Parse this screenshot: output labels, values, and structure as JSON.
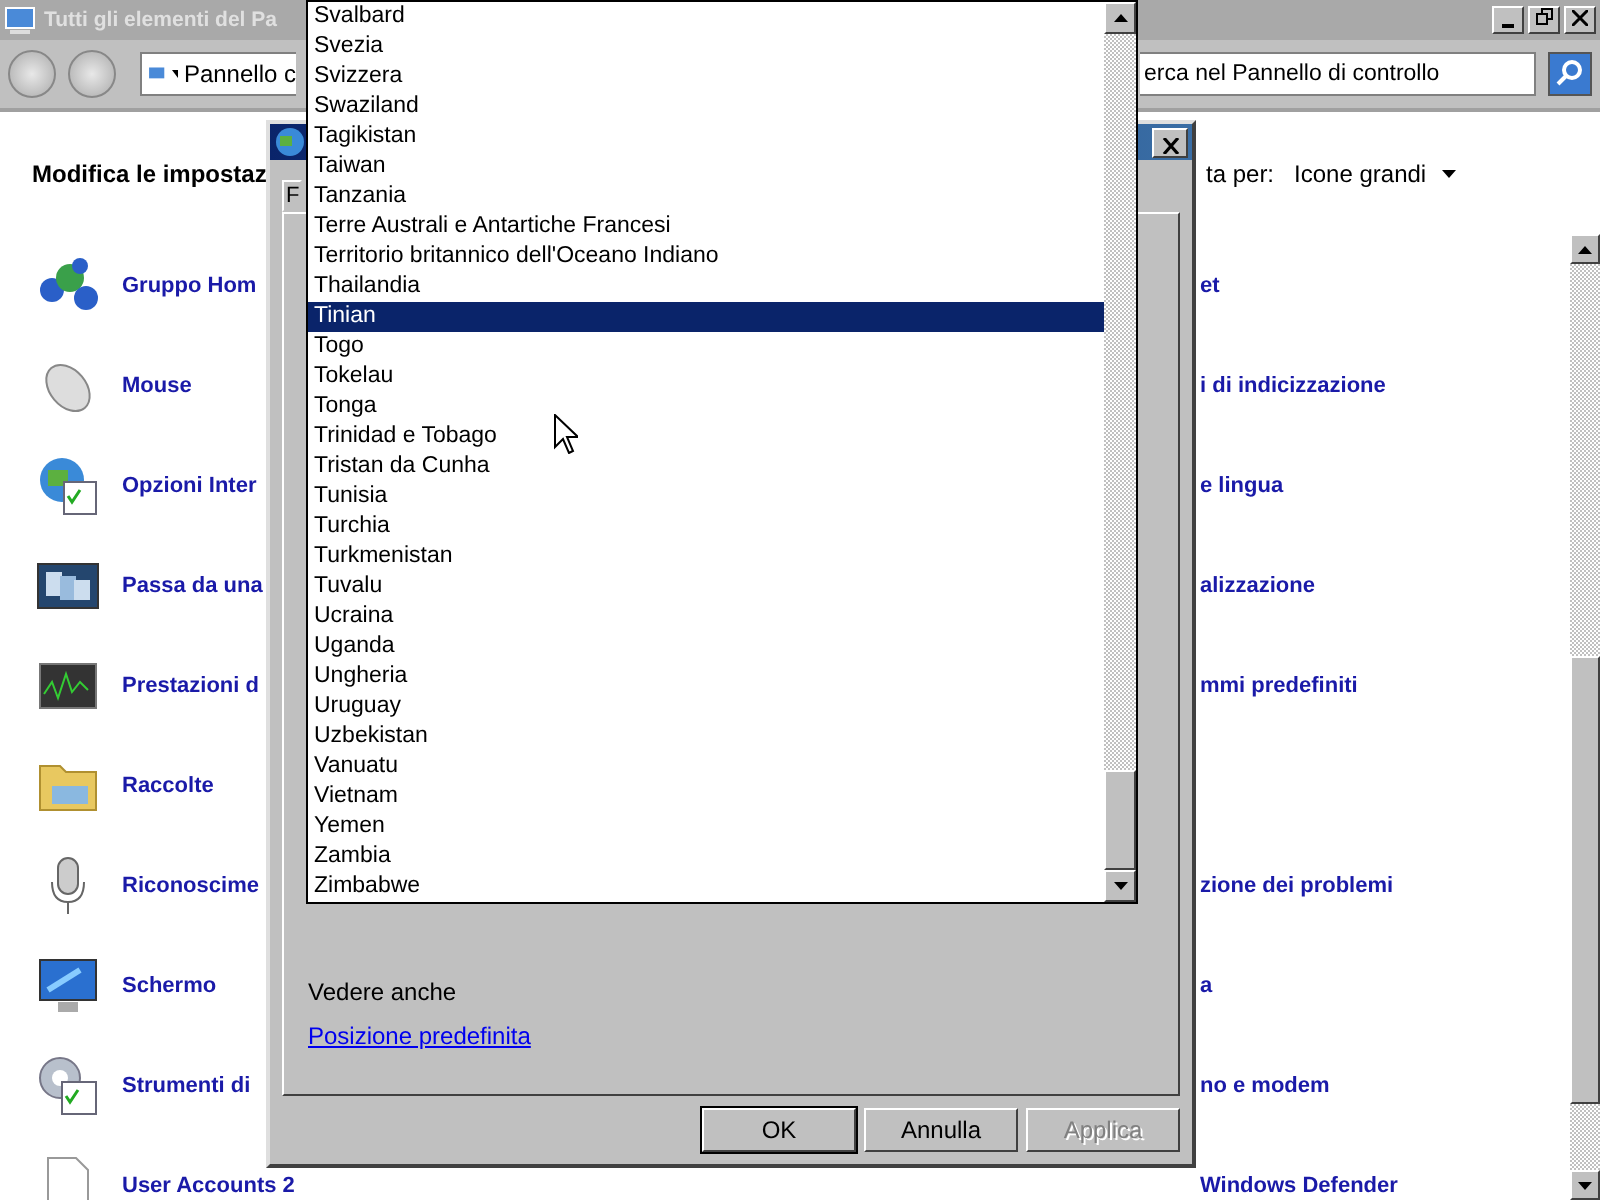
{
  "main_window": {
    "title": "Tutti gli elementi del Pa",
    "address": "Pannello c",
    "search": {
      "value": "erca nel Pannello di controllo"
    },
    "heading": "Modifica le impostaz",
    "view_label": "ta per:",
    "view_value": "Icone grandi",
    "rows": [
      {
        "left": "Gruppo Hom",
        "right": "et"
      },
      {
        "left": "Mouse",
        "right": "i di indicizzazione"
      },
      {
        "left": "Opzioni Inter",
        "right": "e lingua"
      },
      {
        "left": "Passa da una",
        "right": "alizzazione"
      },
      {
        "left": "Prestazioni d",
        "right": "mmi predefiniti"
      },
      {
        "left": "Raccolte"
      },
      {
        "left": "Riconoscime",
        "right": "zione dei problemi"
      },
      {
        "left": "Schermo",
        "right": "a"
      },
      {
        "left": "Strumenti di",
        "right": "no e modem"
      },
      {
        "left": "User Accounts 2",
        "right": "Windows Defender"
      }
    ]
  },
  "dialog": {
    "tab": "F",
    "see_also": "Vedere anche",
    "link": "Posizione predefinita",
    "buttons": [
      {
        "label": "OK",
        "disabled": false,
        "default": true
      },
      {
        "label": "Annulla",
        "disabled": false,
        "default": false
      },
      {
        "label": "Applica",
        "disabled": true,
        "default": false
      }
    ]
  },
  "dropdown": {
    "items": [
      {
        "label": "Svalbard",
        "selected": false
      },
      {
        "label": "Svezia",
        "selected": false
      },
      {
        "label": "Svizzera",
        "selected": false
      },
      {
        "label": "Swaziland",
        "selected": false
      },
      {
        "label": "Tagikistan",
        "selected": false
      },
      {
        "label": "Taiwan",
        "selected": false
      },
      {
        "label": "Tanzania",
        "selected": false
      },
      {
        "label": "Terre Australi e Antartiche Francesi",
        "selected": false
      },
      {
        "label": "Territorio britannico dell'Oceano Indiano",
        "selected": false
      },
      {
        "label": "Thailandia",
        "selected": false
      },
      {
        "label": "Tinian",
        "selected": true
      },
      {
        "label": "Togo",
        "selected": false
      },
      {
        "label": "Tokelau",
        "selected": false
      },
      {
        "label": "Tonga",
        "selected": false
      },
      {
        "label": "Trinidad e Tobago",
        "selected": false
      },
      {
        "label": "Tristan da Cunha",
        "selected": false
      },
      {
        "label": "Tunisia",
        "selected": false
      },
      {
        "label": "Turchia",
        "selected": false
      },
      {
        "label": "Turkmenistan",
        "selected": false
      },
      {
        "label": "Tuvalu",
        "selected": false
      },
      {
        "label": "Ucraina",
        "selected": false
      },
      {
        "label": "Uganda",
        "selected": false
      },
      {
        "label": "Ungheria",
        "selected": false
      },
      {
        "label": "Uruguay",
        "selected": false
      },
      {
        "label": "Uzbekistan",
        "selected": false
      },
      {
        "label": "Vanuatu",
        "selected": false
      },
      {
        "label": "Vietnam",
        "selected": false
      },
      {
        "label": "Yemen",
        "selected": false
      },
      {
        "label": "Zambia",
        "selected": false
      },
      {
        "label": "Zimbabwe",
        "selected": false
      }
    ]
  }
}
